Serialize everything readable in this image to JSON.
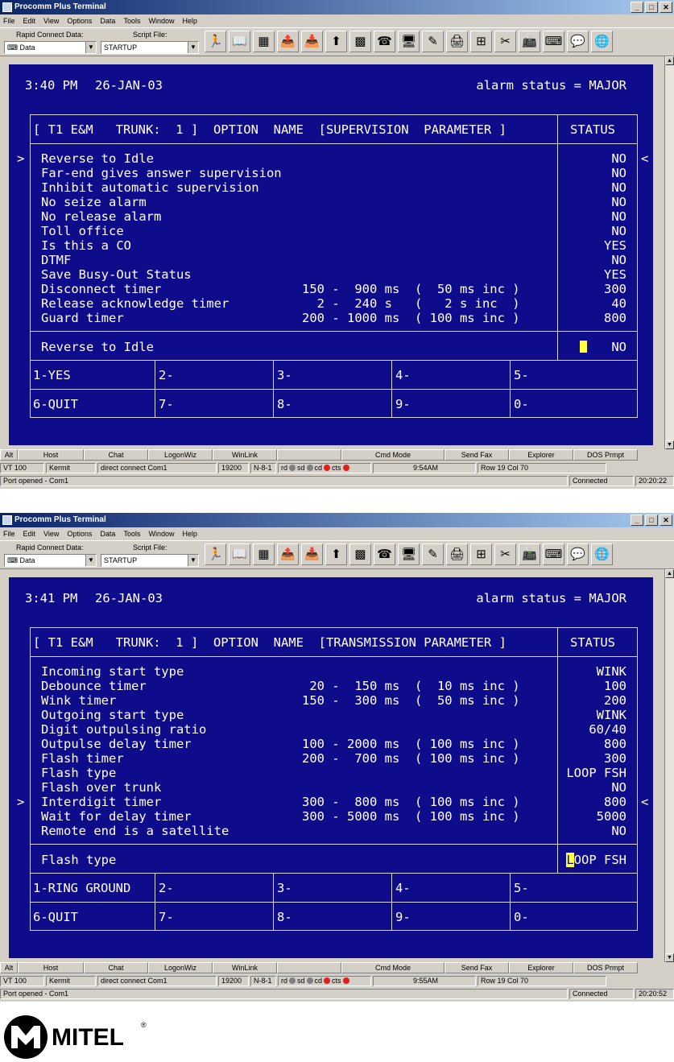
{
  "windows": [
    {
      "title": "Procomm Plus Terminal",
      "menu": [
        "File",
        "Edit",
        "View",
        "Options",
        "Data",
        "Tools",
        "Window",
        "Help"
      ],
      "toolbar": {
        "rapid_connect_label": "Rapid Connect Data:",
        "rapid_connect_value": "Data",
        "script_file_label": "Script File:",
        "script_file_value": "STARTUP"
      },
      "terminal": {
        "time": "3:40 PM",
        "date": "26-JAN-03",
        "alarm": "alarm status = MAJOR",
        "header": "[ T1 E&M   TRUNK:  1 ]  OPTION  NAME  [SUPERVISION  PARAMETER ]",
        "status_header": "STATUS",
        "left_marker": ">",
        "right_marker": "<",
        "rows": [
          {
            "name": "Reverse to Idle",
            "range": "",
            "status": "NO"
          },
          {
            "name": "Far-end gives answer supervision",
            "range": "",
            "status": "NO"
          },
          {
            "name": "Inhibit automatic supervision",
            "range": "",
            "status": "NO"
          },
          {
            "name": "No seize alarm",
            "range": "",
            "status": "NO"
          },
          {
            "name": "No release alarm",
            "range": "",
            "status": "NO"
          },
          {
            "name": "Toll office",
            "range": "",
            "status": "NO"
          },
          {
            "name": "Is this a CO",
            "range": "",
            "status": "YES"
          },
          {
            "name": "DTMF",
            "range": "",
            "status": "NO"
          },
          {
            "name": "Save Busy-Out Status",
            "range": "",
            "status": "YES"
          },
          {
            "name": "Disconnect timer",
            "range": "150 -  900 ms  (  50 ms inc )",
            "status": "300"
          },
          {
            "name": "Release acknowledge timer",
            "range": "  2 -  240 s   (   2 s inc  )",
            "status": "40"
          },
          {
            "name": "Guard timer",
            "range": "200 - 1000 ms  ( 100 ms inc )",
            "status": "800"
          }
        ],
        "selected_name": "Reverse to Idle",
        "selected_value": "NO",
        "selected_value_lead": "",
        "keys": [
          "1-YES",
          "2-",
          "3-",
          "4-",
          "5-",
          "6-QUIT",
          "7-",
          "8-",
          "9-",
          "0-"
        ]
      },
      "status": {
        "row1": [
          "Alt",
          "Host",
          "Chat",
          "LogonWiz",
          "WinLink",
          "",
          "Cmd Mode",
          "Send Fax",
          "Explorer",
          "DOS Prmpt"
        ],
        "emulation": "VT 100",
        "protocol": "Kermit",
        "connection": "direct connect Com1",
        "baud": "19200",
        "params": "N-8-1",
        "leds": [
          "rd",
          "sd",
          "cd",
          "cts"
        ],
        "clock": "9:54AM",
        "row_col": "Row 19   Col 70",
        "message": "Port opened - Com1",
        "conn_state": "Connected",
        "elapsed": "20:20:22"
      }
    },
    {
      "title": "Procomm Plus Terminal",
      "menu": [
        "File",
        "Edit",
        "View",
        "Options",
        "Data",
        "Tools",
        "Window",
        "Help"
      ],
      "toolbar": {
        "rapid_connect_label": "Rapid Connect Data:",
        "rapid_connect_value": "Data",
        "script_file_label": "Script File:",
        "script_file_value": "STARTUP"
      },
      "terminal": {
        "time": "3:41 PM",
        "date": "26-JAN-03",
        "alarm": "alarm status = MAJOR",
        "header": "[ T1 E&M   TRUNK:  1 ]  OPTION  NAME  [TRANSMISSION PARAMETER ]",
        "status_header": "STATUS",
        "left_marker": ">",
        "right_marker": "<",
        "rows": [
          {
            "name": "Incoming start type",
            "range": "",
            "status": "WINK"
          },
          {
            "name": "Debounce timer",
            "range": " 20 -  150 ms  (  10 ms inc )",
            "status": "100"
          },
          {
            "name": "Wink timer",
            "range": "150 -  300 ms  (  50 ms inc )",
            "status": "200"
          },
          {
            "name": "Outgoing start type",
            "range": "",
            "status": "WINK"
          },
          {
            "name": "Digit outpulsing ratio",
            "range": "",
            "status": "60/40"
          },
          {
            "name": "Outpulse delay timer",
            "range": "100 - 2000 ms  ( 100 ms inc )",
            "status": "800"
          },
          {
            "name": "Flash timer",
            "range": "200 -  700 ms  ( 100 ms inc )",
            "status": "300"
          },
          {
            "name": "Flash type",
            "range": "",
            "status": "LOOP FSH"
          },
          {
            "name": "Flash over trunk",
            "range": "",
            "status": "NO"
          },
          {
            "name": "Interdigit timer",
            "range": "300 -  800 ms  ( 100 ms inc )",
            "status": "800"
          },
          {
            "name": "Wait for delay timer",
            "range": "300 - 5000 ms  ( 100 ms inc )",
            "status": "5000"
          },
          {
            "name": "Remote end is a satellite",
            "range": "",
            "status": "NO"
          }
        ],
        "selected_name": "Flash type",
        "selected_value": "OOP FSH",
        "selected_value_lead": "L",
        "keys": [
          "1-RING GROUND",
          "2-",
          "3-",
          "4-",
          "5-",
          "6-QUIT",
          "7-",
          "8-",
          "9-",
          "0-"
        ]
      },
      "status": {
        "row1": [
          "Alt",
          "Host",
          "Chat",
          "LogonWiz",
          "WinLink",
          "",
          "Cmd Mode",
          "Send Fax",
          "Explorer",
          "DOS Prmpt"
        ],
        "emulation": "VT 100",
        "protocol": "Kermit",
        "connection": "direct connect Com1",
        "baud": "19200",
        "params": "N-8-1",
        "leds": [
          "rd",
          "sd",
          "cd",
          "cts"
        ],
        "clock": "9:55AM",
        "row_col": "Row 19   Col 70",
        "message": "Port opened - Com1",
        "conn_state": "Connected",
        "elapsed": "20:20:52"
      }
    }
  ],
  "logo": {
    "text": "MITEL",
    "mark": "®"
  },
  "colors": {
    "terminal_bg": "#0e0c8a",
    "terminal_fg": "#ffffff",
    "cursor": "#ffff40",
    "titlebar": "#0a246a",
    "chrome": "#d4d0c8"
  },
  "icons": [
    "connect-icon",
    "phonebook-icon",
    "mode-icon",
    "send-file-icon",
    "receive-file-icon",
    "upload-icon",
    "meta-icon",
    "hangup-icon",
    "monitor-icon",
    "cable-icon",
    "printer-icon",
    "capture-icon",
    "script-icon",
    "fax-icon",
    "keyboard-icon",
    "chat-icon",
    "globe-icon"
  ]
}
